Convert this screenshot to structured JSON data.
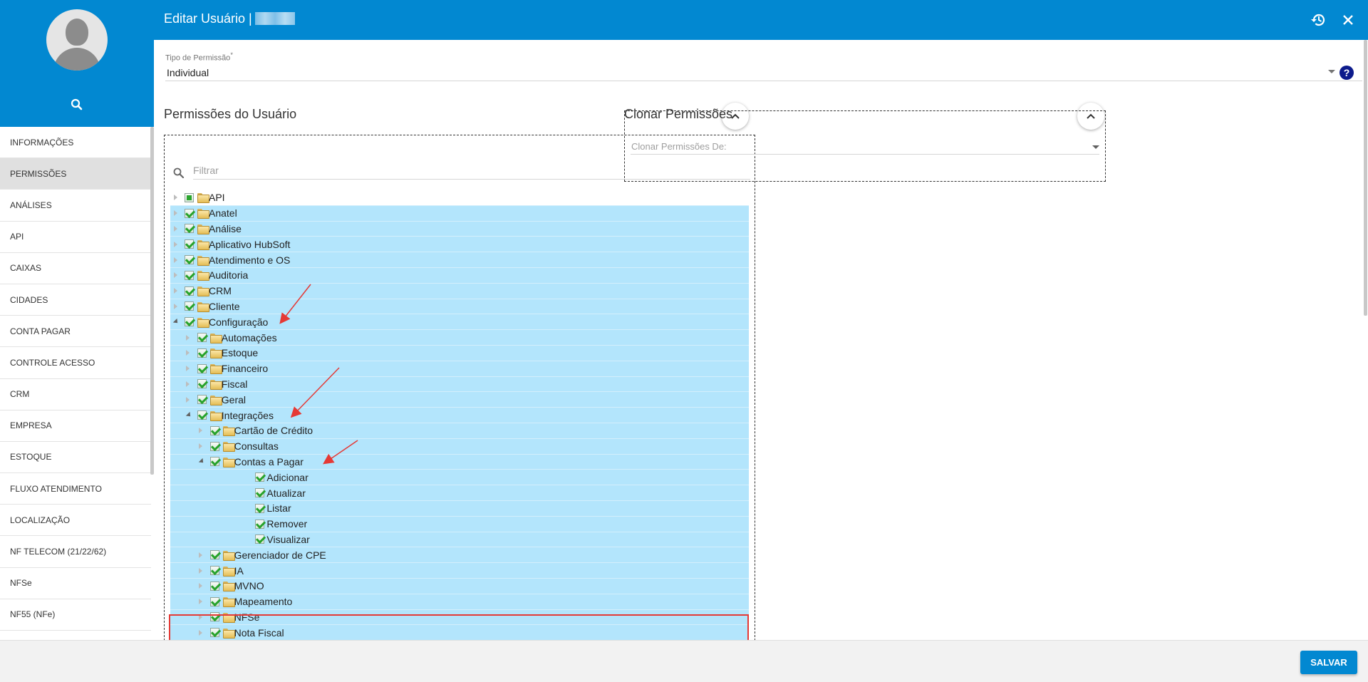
{
  "header": {
    "title": "Editar Usuário |",
    "history_icon": "history-icon",
    "close_icon": "close-icon"
  },
  "sidebar": {
    "search_icon": "search-icon",
    "items": [
      {
        "label": "INFORMAÇÕES",
        "active": false
      },
      {
        "label": "PERMISSÕES",
        "active": true
      },
      {
        "label": "ANÁLISES",
        "active": false
      },
      {
        "label": "API",
        "active": false
      },
      {
        "label": "CAIXAS",
        "active": false
      },
      {
        "label": "CIDADES",
        "active": false
      },
      {
        "label": "CONTA PAGAR",
        "active": false
      },
      {
        "label": "CONTROLE ACESSO",
        "active": false
      },
      {
        "label": "CRM",
        "active": false
      },
      {
        "label": "EMPRESA",
        "active": false
      },
      {
        "label": "ESTOQUE",
        "active": false
      },
      {
        "label": "FLUXO ATENDIMENTO",
        "active": false
      },
      {
        "label": "LOCALIZAÇÃO",
        "active": false
      },
      {
        "label": "NF TELECOM (21/22/62)",
        "active": false
      },
      {
        "label": "NFSe",
        "active": false
      },
      {
        "label": "NF55 (NFe)",
        "active": false
      }
    ]
  },
  "permission_type": {
    "label": "Tipo de Permissão",
    "required_mark": "*",
    "value": "Individual"
  },
  "user_permissions": {
    "title": "Permissões do Usuário",
    "filter_placeholder": "Filtrar",
    "tree": [
      {
        "label": "API",
        "level": 0,
        "toggle": "closed",
        "check": "partial",
        "selected": false
      },
      {
        "label": "Anatel",
        "level": 0,
        "toggle": "closed",
        "check": "checked",
        "selected": true
      },
      {
        "label": "Análise",
        "level": 0,
        "toggle": "closed",
        "check": "checked",
        "selected": true
      },
      {
        "label": "Aplicativo HubSoft",
        "level": 0,
        "toggle": "closed",
        "check": "checked",
        "selected": true
      },
      {
        "label": "Atendimento e OS",
        "level": 0,
        "toggle": "closed",
        "check": "checked",
        "selected": true
      },
      {
        "label": "Auditoria",
        "level": 0,
        "toggle": "closed",
        "check": "checked",
        "selected": true
      },
      {
        "label": "CRM",
        "level": 0,
        "toggle": "closed",
        "check": "checked",
        "selected": true
      },
      {
        "label": "Cliente",
        "level": 0,
        "toggle": "closed",
        "check": "checked",
        "selected": true
      },
      {
        "label": "Configuração",
        "level": 0,
        "toggle": "open",
        "check": "checked",
        "selected": true
      },
      {
        "label": "Automações",
        "level": 1,
        "toggle": "closed",
        "check": "checked",
        "selected": true
      },
      {
        "label": "Estoque",
        "level": 1,
        "toggle": "closed",
        "check": "checked",
        "selected": true
      },
      {
        "label": "Financeiro",
        "level": 1,
        "toggle": "closed",
        "check": "checked",
        "selected": true
      },
      {
        "label": "Fiscal",
        "level": 1,
        "toggle": "closed",
        "check": "checked",
        "selected": true
      },
      {
        "label": "Geral",
        "level": 1,
        "toggle": "closed",
        "check": "checked",
        "selected": true
      },
      {
        "label": "Integrações",
        "level": 1,
        "toggle": "open",
        "check": "checked",
        "selected": true
      },
      {
        "label": "Cartão de Crédito",
        "level": 2,
        "toggle": "closed",
        "check": "checked",
        "selected": true
      },
      {
        "label": "Consultas",
        "level": 2,
        "toggle": "closed",
        "check": "checked",
        "selected": true
      },
      {
        "label": "Contas a Pagar",
        "level": 2,
        "toggle": "open",
        "check": "checked",
        "selected": true
      },
      {
        "label": "Adicionar",
        "level": 3,
        "toggle": "none",
        "check": "checked",
        "selected": true,
        "leaf": true
      },
      {
        "label": "Atualizar",
        "level": 3,
        "toggle": "none",
        "check": "checked",
        "selected": true,
        "leaf": true
      },
      {
        "label": "Listar",
        "level": 3,
        "toggle": "none",
        "check": "checked",
        "selected": true,
        "leaf": true
      },
      {
        "label": "Remover",
        "level": 3,
        "toggle": "none",
        "check": "checked",
        "selected": true,
        "leaf": true
      },
      {
        "label": "Visualizar",
        "level": 3,
        "toggle": "none",
        "check": "checked",
        "selected": true,
        "leaf": true
      },
      {
        "label": "Gerenciador de CPE",
        "level": 2,
        "toggle": "closed",
        "check": "checked",
        "selected": true
      },
      {
        "label": "IA",
        "level": 2,
        "toggle": "closed",
        "check": "checked",
        "selected": true
      },
      {
        "label": "MVNO",
        "level": 2,
        "toggle": "closed",
        "check": "checked",
        "selected": true
      },
      {
        "label": "Mapeamento",
        "level": 2,
        "toggle": "closed",
        "check": "checked",
        "selected": true
      },
      {
        "label": "NFSe",
        "level": 2,
        "toggle": "closed",
        "check": "checked",
        "selected": true
      },
      {
        "label": "Nota Fiscal",
        "level": 2,
        "toggle": "closed",
        "check": "checked",
        "selected": true
      }
    ]
  },
  "clone_permissions": {
    "title": "Clonar Permissões",
    "select_label": "Clonar Permissões De:"
  },
  "footer": {
    "save_label": "SALVAR"
  },
  "colors": {
    "primary": "#0288d1",
    "selected_row": "#b3e5fc",
    "annotation_red": "#e53935"
  }
}
